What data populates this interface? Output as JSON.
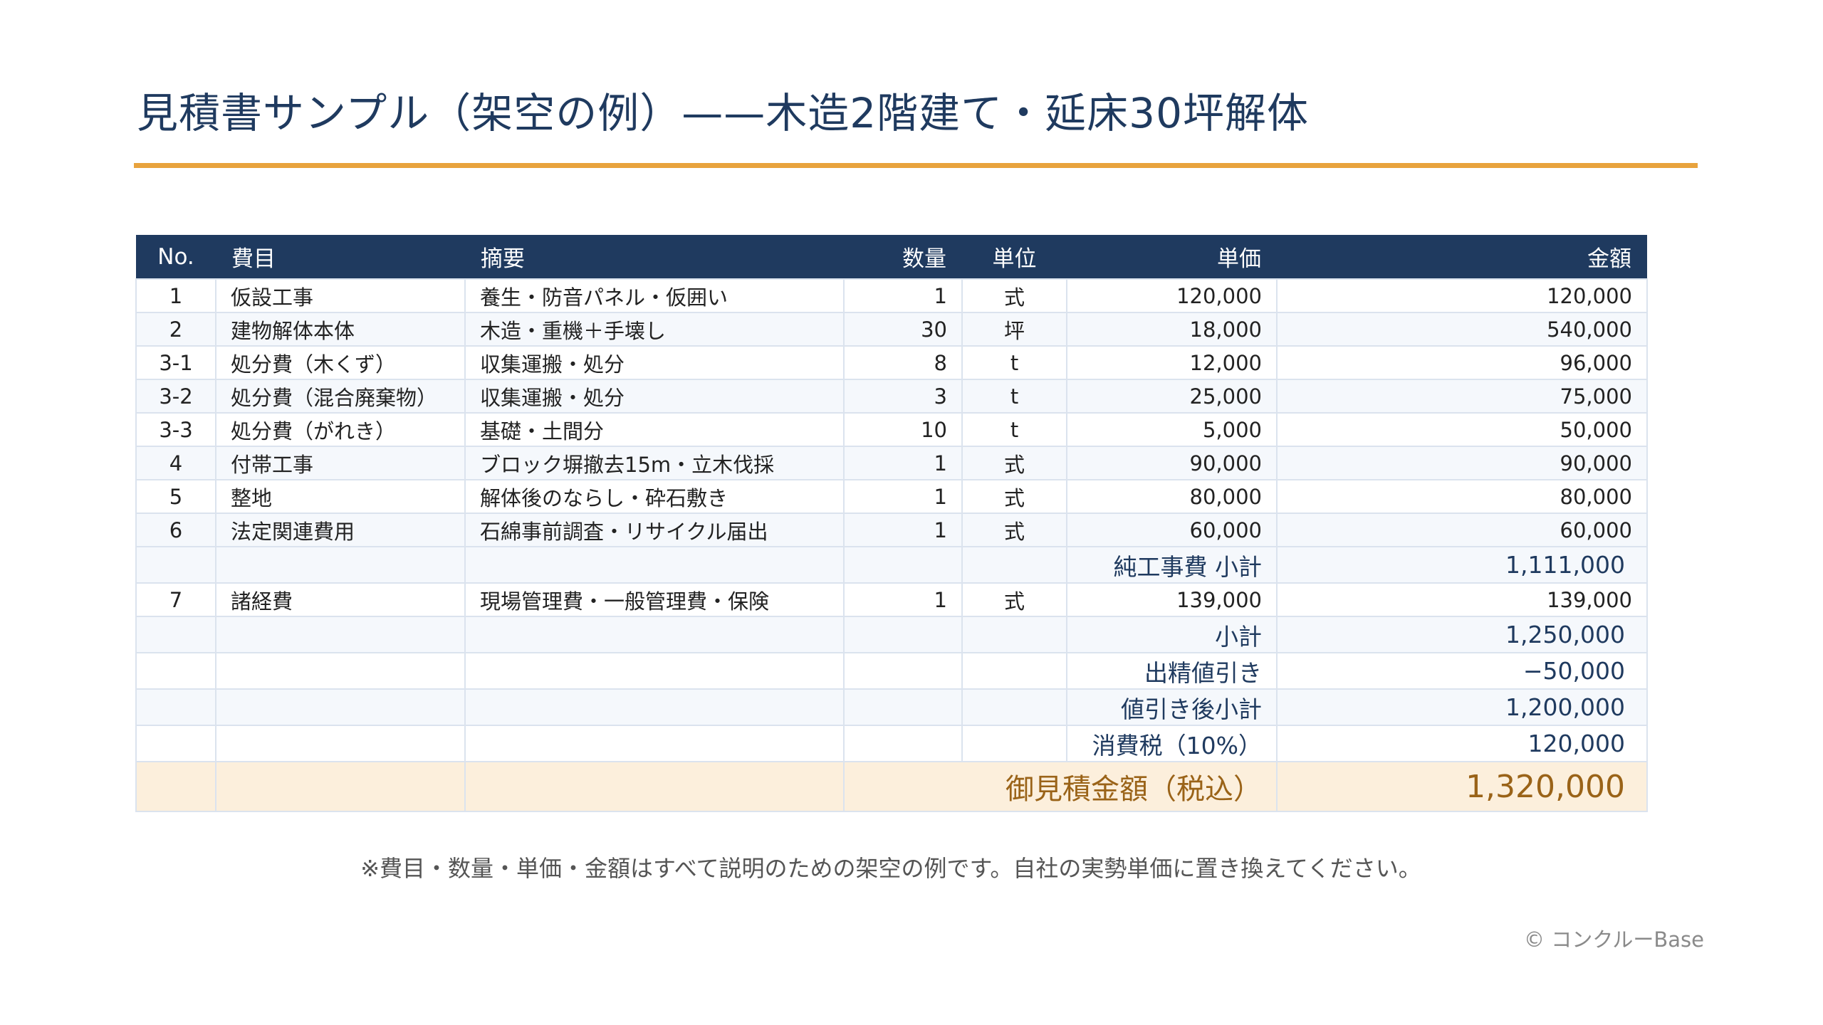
{
  "title": "見積書サンプル（架空の例）——木造2階建て・延床30坪解体",
  "table": {
    "headers": {
      "no": "No.",
      "item": "費目",
      "desc": "摘要",
      "qty": "数量",
      "unit": "単位",
      "price": "単価",
      "amount": "金額"
    },
    "rows": [
      {
        "no": "1",
        "item": "仮設工事",
        "desc": "養生・防音パネル・仮囲い",
        "qty": "1",
        "unit": "式",
        "price": "120,000",
        "amount": "120,000"
      },
      {
        "no": "2",
        "item": "建物解体本体",
        "desc": "木造・重機＋手壊し",
        "qty": "30",
        "unit": "坪",
        "price": "18,000",
        "amount": "540,000"
      },
      {
        "no": "3-1",
        "item": "処分費（木くず）",
        "desc": "収集運搬・処分",
        "qty": "8",
        "unit": "t",
        "price": "12,000",
        "amount": "96,000"
      },
      {
        "no": "3-2",
        "item": "処分費（混合廃棄物）",
        "desc": "収集運搬・処分",
        "qty": "3",
        "unit": "t",
        "price": "25,000",
        "amount": "75,000"
      },
      {
        "no": "3-3",
        "item": "処分費（がれき）",
        "desc": "基礎・土間分",
        "qty": "10",
        "unit": "t",
        "price": "5,000",
        "amount": "50,000"
      },
      {
        "no": "4",
        "item": "付帯工事",
        "desc": "ブロック塀撤去15m・立木伐採",
        "qty": "1",
        "unit": "式",
        "price": "90,000",
        "amount": "90,000"
      },
      {
        "no": "5",
        "item": "整地",
        "desc": "解体後のならし・砕石敷き",
        "qty": "1",
        "unit": "式",
        "price": "80,000",
        "amount": "80,000"
      },
      {
        "no": "6",
        "item": "法定関連費用",
        "desc": "石綿事前調査・リサイクル届出",
        "qty": "1",
        "unit": "式",
        "price": "60,000",
        "amount": "60,000"
      }
    ],
    "net_subtotal": {
      "label": "純工事費 小計",
      "value": "1,111,000"
    },
    "overhead": {
      "no": "7",
      "item": "諸経費",
      "desc": "現場管理費・一般管理費・保険",
      "qty": "1",
      "unit": "式",
      "price": "139,000",
      "amount": "139,000"
    },
    "summary": [
      {
        "label": "小計",
        "value": "1,250,000"
      },
      {
        "label": "出精値引き",
        "value": "−50,000"
      },
      {
        "label": "値引き後小計",
        "value": "1,200,000"
      },
      {
        "label": "消費税（10%）",
        "value": "120,000"
      }
    ],
    "total": {
      "label": "御見積金額（税込）",
      "value": "1,320,000"
    }
  },
  "footnote": "※費目・数量・単価・金額はすべて説明のための架空の例です。自社の実勢単価に置き換えてください。",
  "copyright": "© コンクルーBase",
  "colors": {
    "header_bg": "#1f3a5f",
    "accent_rule": "#e8a33d",
    "total_bg": "#fcefdc",
    "total_text": "#9a6318"
  }
}
